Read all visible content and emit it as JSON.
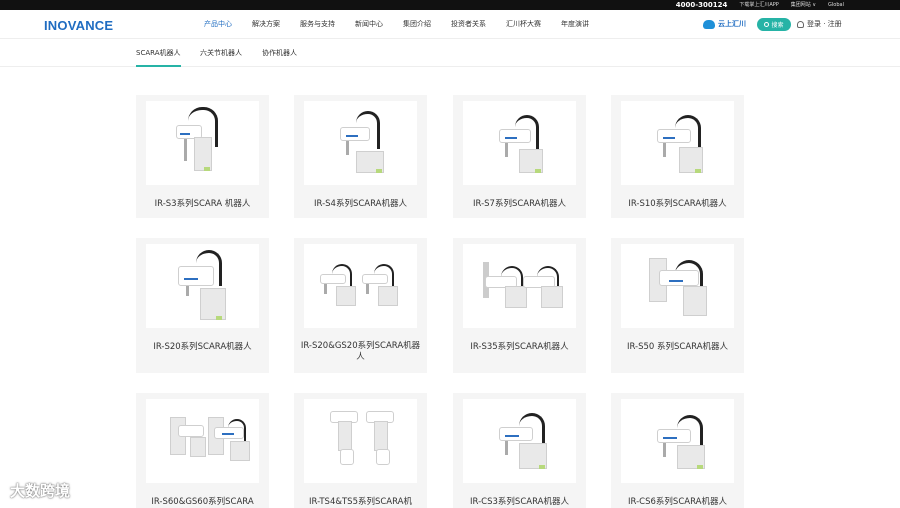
{
  "topbar": {
    "phone": "4000-300124",
    "app": "下载掌上汇川APP",
    "sites": "集团网站 ∨",
    "global": "Global"
  },
  "header": {
    "logo": "INOVANCE",
    "nav": [
      "产品中心",
      "解决方案",
      "服务与支持",
      "新闻中心",
      "集团介绍",
      "投资者关系",
      "汇川杯大赛",
      "年度演讲"
    ],
    "cloud": "云上汇川",
    "search": "搜索",
    "login": "登录 · 注册"
  },
  "subtabs": [
    "SCARA机器人",
    "六关节机器人",
    "协作机器人"
  ],
  "products": [
    "IR-S3系列SCARA 机器人",
    "IR-S4系列SCARA机器人",
    "IR-S7系列SCARA机器人",
    "IR-S10系列SCARA机器人",
    "IR-S20系列SCARA机器人",
    "IR-S20&GS20系列SCARA机器人",
    "IR-S35系列SCARA机器人",
    "IR-S50 系列SCARA机器人",
    "IR-S60&GS60系列SCARA",
    "IR-TS4&TS5系列SCARA机",
    "IR-CS3系列SCARA机器人",
    "IR-CS6系列SCARA机器人"
  ],
  "watermark": "大数跨境",
  "colors": {
    "brand": "#1f6cc1",
    "accent": "#26b3a6"
  }
}
